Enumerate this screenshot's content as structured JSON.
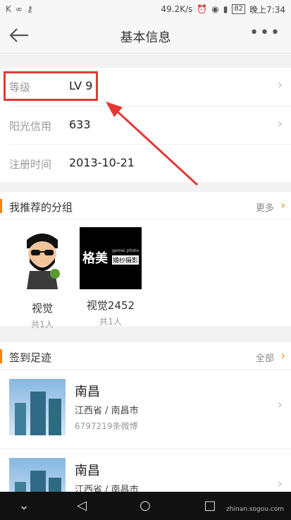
{
  "status_bar": {
    "left_icons": [
      "K",
      "∞",
      "⚷"
    ],
    "speed": "49.2K/s",
    "battery": "82",
    "time": "晚上7:34"
  },
  "app_bar": {
    "title": "基本信息"
  },
  "info": [
    {
      "label": "等级",
      "value": "LV 9"
    },
    {
      "label": "阳光信用",
      "value": "633"
    },
    {
      "label": "注册时间",
      "value": "2013-10-21"
    }
  ],
  "groups_section": {
    "title": "我推荐的分组",
    "more": "更多",
    "items": [
      {
        "name": "视觉",
        "count": "共1人"
      },
      {
        "name": "视觉2452",
        "count": "共1人",
        "logo_text": "格美",
        "logo_sub": "gemei photo",
        "logo_tag": "婚纱摄影"
      }
    ]
  },
  "checkin_section": {
    "title": "签到足迹",
    "more": "全部",
    "places": [
      {
        "name": "南昌",
        "location": "江西省 / 南昌市",
        "weibo": "6797219条微博"
      },
      {
        "name": "南昌",
        "location": "江西省 / 南昌市",
        "weibo": ""
      }
    ]
  },
  "watermark": "zhinan.sogou.com",
  "colors": {
    "accent": "#ff8200",
    "highlight": "#e53935"
  }
}
